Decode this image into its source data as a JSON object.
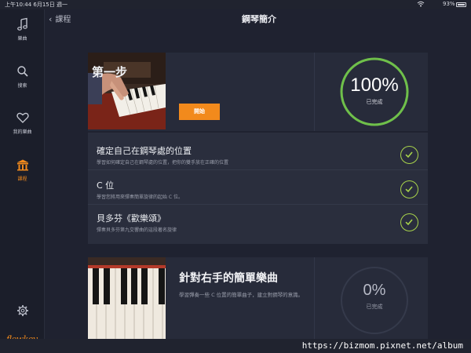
{
  "status_bar": {
    "time": "上午10:44  6月15日 週一",
    "battery": "93%"
  },
  "sidebar": {
    "items": [
      {
        "label": "樂曲",
        "icon": "music-note-icon"
      },
      {
        "label": "搜索",
        "icon": "search-icon"
      },
      {
        "label": "我的樂曲",
        "icon": "heart-icon"
      },
      {
        "label": "課程",
        "icon": "course-icon",
        "active": true
      }
    ],
    "settings_icon": "gear-icon",
    "logo": "flowkey"
  },
  "header": {
    "back_label": "課程",
    "title": "鋼琴簡介"
  },
  "lesson1": {
    "title": "第一步",
    "start_label": "開始",
    "progress_value": "100%",
    "progress_fraction": 1.0,
    "progress_label": "已完成",
    "steps": [
      {
        "title": "確定自己在鋼琴處的位置",
        "description": "學習如何確定自己在鋼琴處的位置，把你的雙手放在正確的位置",
        "completed": true
      },
      {
        "title": "C 位",
        "description": "學習您將用來彈奏簡單旋律的起始 C 位。",
        "completed": true
      },
      {
        "title": "貝多芬《歡樂頌》",
        "description": "彈奏貝多芬第九交響曲的這段著名旋律",
        "completed": true
      }
    ]
  },
  "lesson2": {
    "title": "針對右手的簡單樂曲",
    "description": "學習彈奏一些 C 位置的簡單曲子，建立對鋼琴的意識。",
    "progress_value": "0%",
    "progress_fraction": 0.0,
    "progress_label": "已完成"
  },
  "watermark": "https://bizmom.pixnet.net/album",
  "colors": {
    "accent": "#f28a1c",
    "complete": "#6fc04a",
    "check": "#a8d34b",
    "background": "#1f2230",
    "card": "#272b3a"
  }
}
